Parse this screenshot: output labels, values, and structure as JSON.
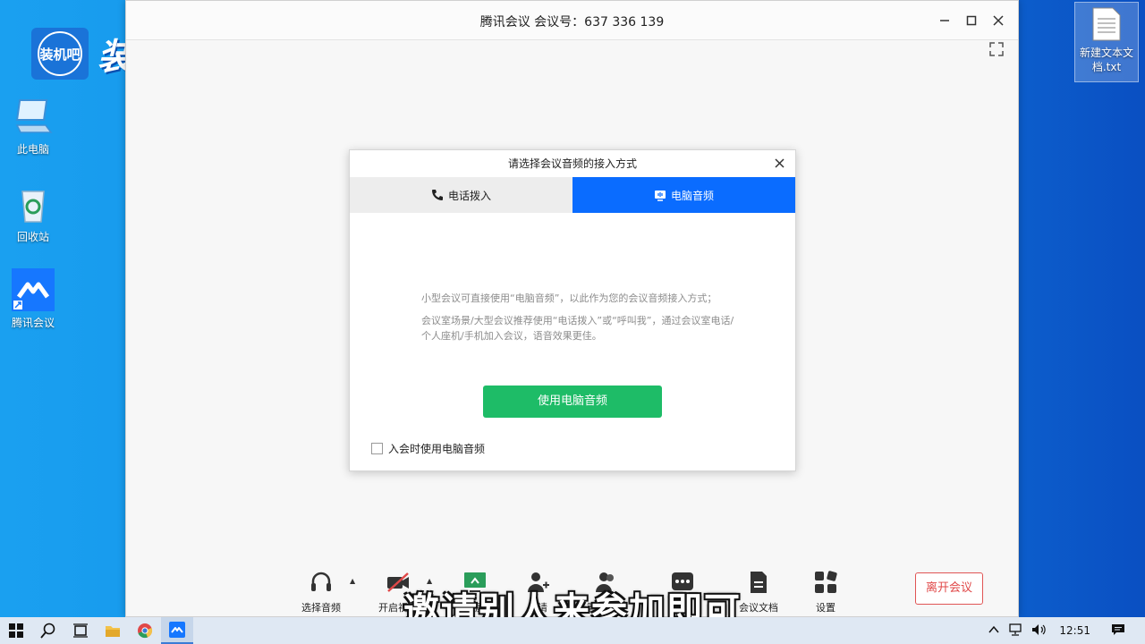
{
  "desktop": {
    "logo_badge": "装机吧",
    "logo_text": "装机吧",
    "icons": [
      {
        "label": "此电脑"
      },
      {
        "label": "回收站"
      },
      {
        "label": "腾讯会议"
      }
    ],
    "file": {
      "label": "新建文本文档.txt"
    }
  },
  "window": {
    "title": "腾讯会议 会议号：637 336 139"
  },
  "dialog": {
    "title": "请选择会议音频的接入方式",
    "tabs": [
      {
        "label": "电话拨入",
        "active": false
      },
      {
        "label": "电脑音频",
        "active": true
      }
    ],
    "desc_line1": "小型会议可直接使用“电脑音频”，以此作为您的会议音频接入方式；",
    "desc_line2": "会议室场景/大型会议推荐使用“电话拨入”或“呼叫我”，通过会议室电话/个人座机/手机加入会议，语音效果更佳。",
    "primary_button": "使用电脑音频",
    "checkbox_label": "入会时使用电脑音频"
  },
  "toolbar": {
    "items": [
      {
        "label": "选择音频"
      },
      {
        "label": "开启视频"
      },
      {
        "label": "共享屏幕"
      },
      {
        "label": "邀请"
      },
      {
        "label": "管理成员"
      },
      {
        "label": "更多"
      },
      {
        "label": "会议文档"
      },
      {
        "label": "设置"
      }
    ],
    "leave_button": "离开会议"
  },
  "subtitle": "邀请别人来参加即可",
  "taskbar": {
    "clock": "12:51"
  },
  "colors": {
    "accent": "#0a6cff",
    "primary_green": "#1ebc67",
    "leave_red": "#e04848"
  }
}
